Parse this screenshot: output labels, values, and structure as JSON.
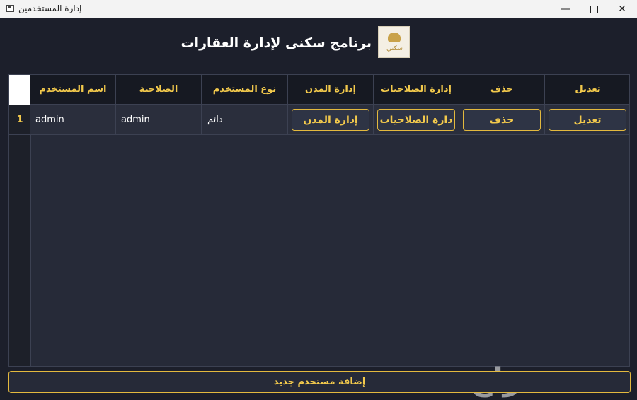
{
  "window": {
    "title": "إدارة المستخدمين",
    "controls": {
      "minimize": "—",
      "close": "✕"
    }
  },
  "header": {
    "app_title": "برنامج سكنى لإدارة العقارات",
    "logo_text": "سكني"
  },
  "table": {
    "columns": [
      "اسم المستخدم",
      "الصلاحية",
      "نوع المستخدم",
      "إدارة المدن",
      "إدارة الصلاحيات",
      "حذف",
      "تعديل"
    ],
    "rows": [
      {
        "num": "1",
        "username": "admin",
        "role": "admin",
        "user_type": "دائم",
        "manage_cities": "إدارة المدن",
        "manage_permissions": "دارة الصلاحيات",
        "delete": "حذف",
        "edit": "تعديل"
      }
    ]
  },
  "footer": {
    "add_user": "إضافة مستخدم جديد"
  },
  "watermark": "حراج",
  "colors": {
    "background": "#1c1f2b",
    "accent": "#f2c94c",
    "header_bg": "#161922"
  }
}
